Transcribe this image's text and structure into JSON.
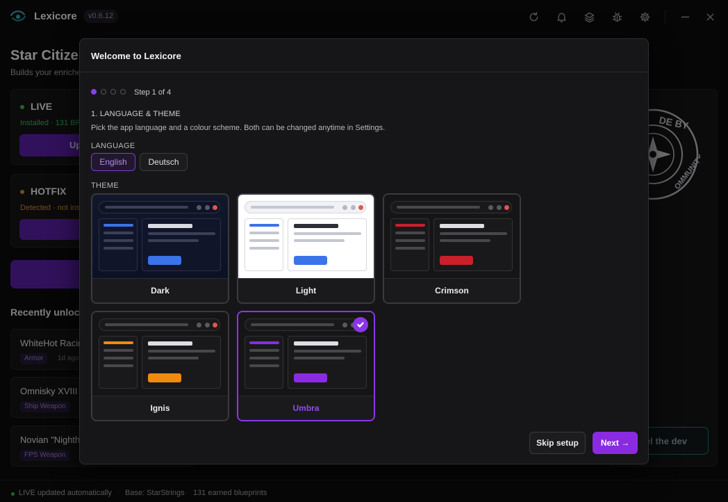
{
  "app": {
    "name": "Lexicore",
    "version": "v0.6.12"
  },
  "titlebar": {
    "icons": [
      "refresh-icon",
      "bell-icon",
      "layers-icon",
      "bug-icon",
      "gear-icon",
      "minimize-icon",
      "close-icon"
    ]
  },
  "background": {
    "page_title": "Star Citizen",
    "page_subtitle": "Builds your enriche",
    "cards": [
      {
        "label": "LIVE",
        "detail": "Installed · 131 BP",
        "button": "Up",
        "color": "#3fb950"
      },
      {
        "label": "HOTFIX",
        "detail": "Detected · not ins",
        "button": "",
        "color": "#d98a2b"
      }
    ],
    "section_title": "Recently unloc",
    "items": [
      {
        "name": "WhiteHot Racin",
        "tag": "Armor",
        "time": "1d ago"
      },
      {
        "name": "Omnisky XVIII",
        "tag": "Ship Weapon",
        "time": ""
      },
      {
        "name": "Novian \"Nighth",
        "tag": "FPS Weapon",
        "time": ""
      }
    ],
    "emblem_text": "MADE BY THE COMMUNITY",
    "dev_button": "el the dev"
  },
  "footer": {
    "status": "LIVE updated automatically",
    "base": "Base: StarStrings",
    "blueprints": "131 earned blueprints",
    "status_color": "#3fb950"
  },
  "modal": {
    "title": "Welcome to Lexicore",
    "step_text": "Step 1 of 4",
    "step_total": 4,
    "step_current": 1,
    "section_heading": "1. LANGUAGE & THEME",
    "section_desc": "Pick the app language and a colour scheme. Both can be changed anytime in Settings.",
    "language_label": "LANGUAGE",
    "languages": [
      {
        "label": "English",
        "selected": true
      },
      {
        "label": "Deutsch",
        "selected": false
      }
    ],
    "theme_label": "THEME",
    "themes": [
      {
        "name": "Dark",
        "accent": "#3b73e8",
        "selected": false
      },
      {
        "name": "Light",
        "accent": "#3b73e8",
        "selected": false
      },
      {
        "name": "Crimson",
        "accent": "#c9202b",
        "selected": false
      },
      {
        "name": "Ignis",
        "accent": "#f08a10",
        "selected": false
      },
      {
        "name": "Umbra",
        "accent": "#8a2be2",
        "selected": true
      }
    ],
    "skip_label": "Skip setup",
    "next_label": "Next →"
  }
}
